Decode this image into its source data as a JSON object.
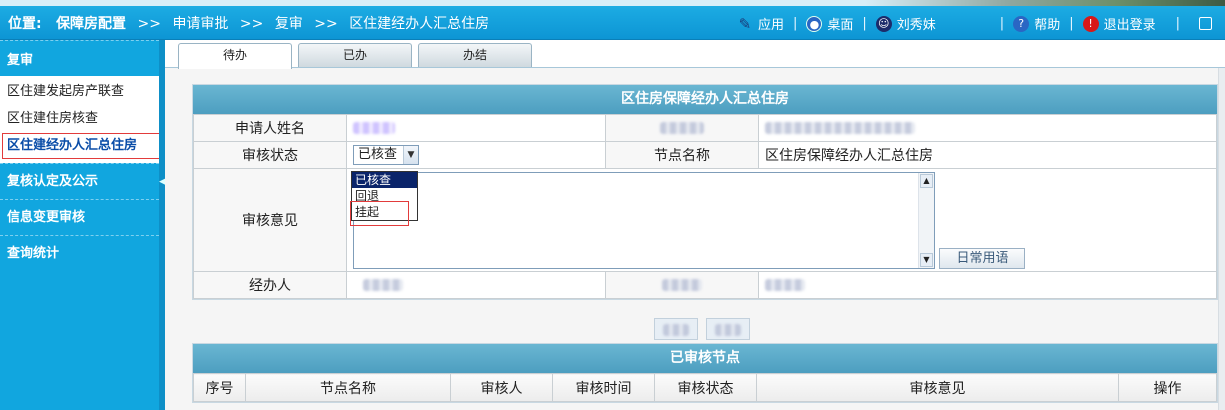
{
  "header": {
    "location_label": "位置:",
    "crumbs": [
      "保障房配置",
      "申请审批",
      "复审",
      "区住建经办人汇总住房"
    ],
    "separator": ">>",
    "app": "应用",
    "desktop": "桌面",
    "user": "刘秀妹",
    "help": "帮助",
    "logout": "退出登录"
  },
  "sidebar": {
    "section": "复审",
    "items": [
      "区住建发起房产联查",
      "区住建住房核查",
      "区住建经办人汇总住房"
    ],
    "groups": [
      "复核认定及公示",
      "信息变更审核",
      "查询统计"
    ]
  },
  "tabs": [
    "待办",
    "已办",
    "办结"
  ],
  "form": {
    "title": "区住房保障经办人汇总住房",
    "applicant_label": "申请人姓名",
    "status_label": "审核状态",
    "status_selected": "已核查",
    "status_options": [
      "已核查",
      "回退",
      "挂起"
    ],
    "node_label": "节点名称",
    "node_value": "区住房保障经办人汇总住房",
    "opinion_label": "审核意见",
    "common_phrases": "日常用语",
    "handler_label": "经办人"
  },
  "nodes": {
    "title": "已审核节点",
    "columns": [
      "序号",
      "节点名称",
      "审核人",
      "审核时间",
      "审核状态",
      "审核意见",
      "操作"
    ]
  },
  "colors": {
    "header_blue": "#0d95d4",
    "sidebar_blue": "#11a6df",
    "panel_title": "#4d9ec0",
    "highlight_red": "#e23b3b"
  }
}
